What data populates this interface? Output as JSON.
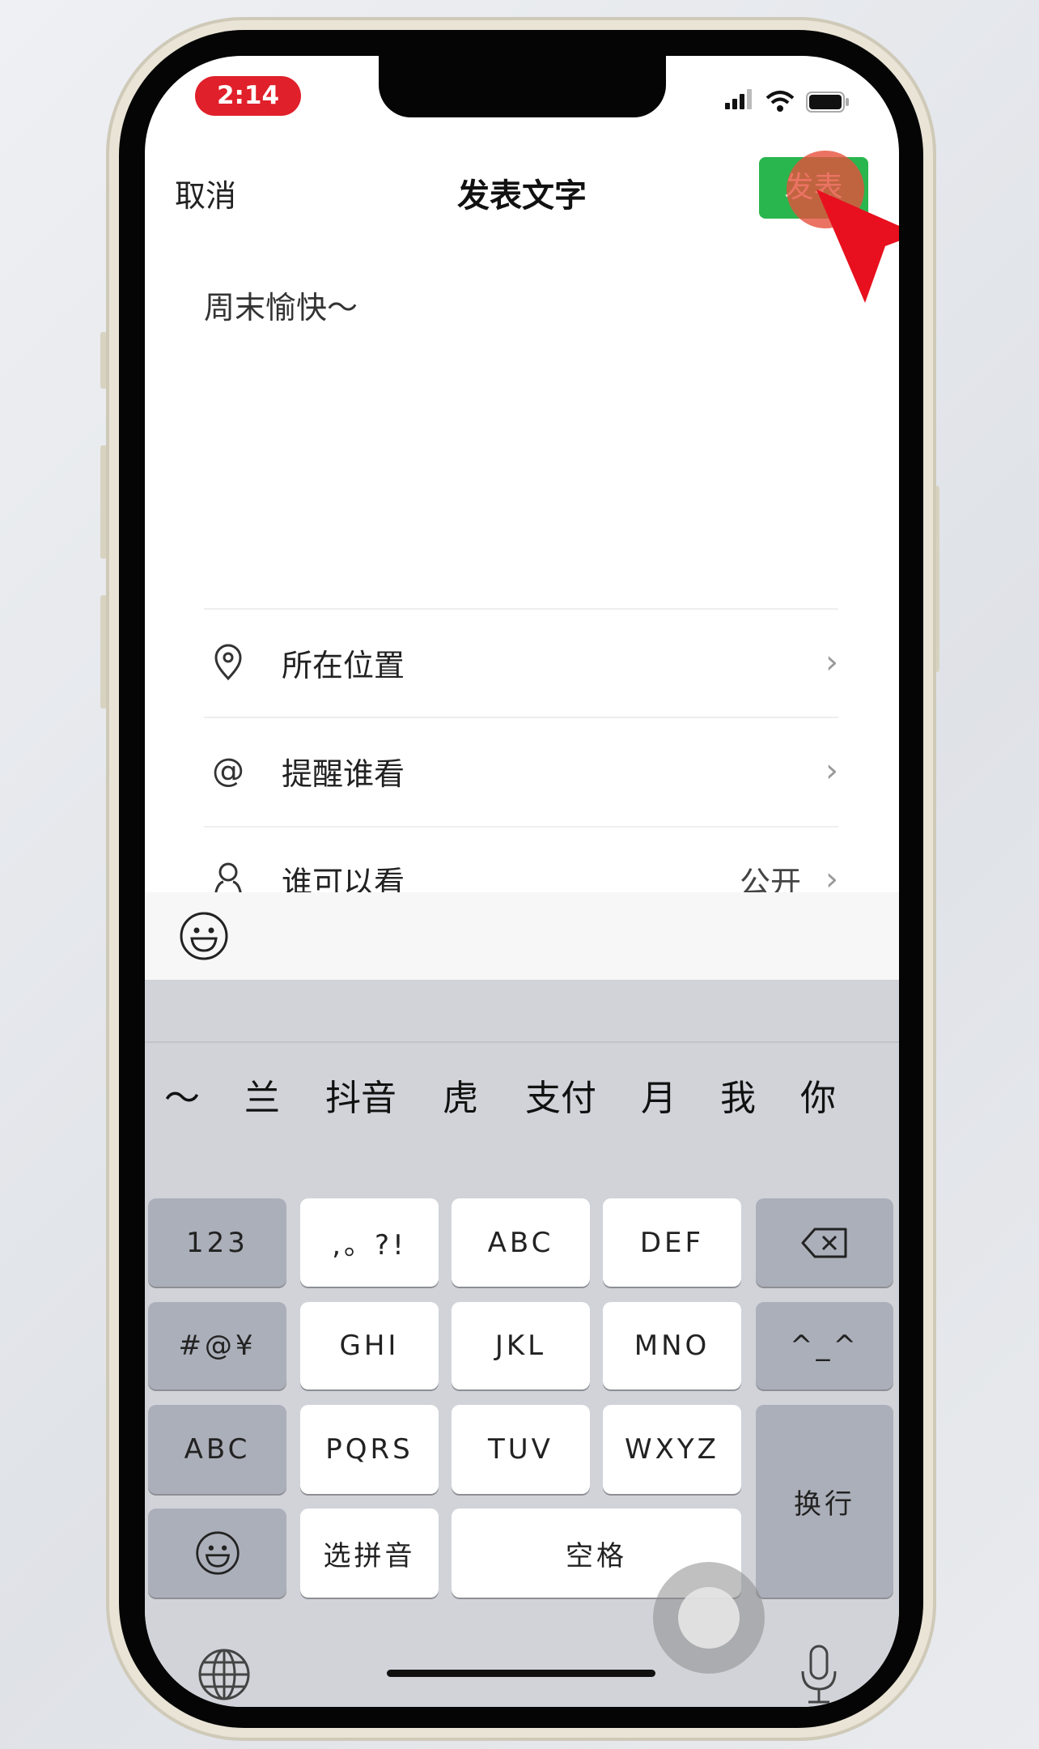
{
  "status_bar": {
    "time": "2:14",
    "signal_icon": "cellular-signal-icon",
    "wifi_icon": "wifi-icon",
    "battery_icon": "battery-icon"
  },
  "nav": {
    "cancel_label": "取消",
    "title": "发表文字",
    "send_label": "发表"
  },
  "compose": {
    "text": "周末愉快～"
  },
  "options": [
    {
      "icon": "location-pin-icon",
      "label": "所在位置",
      "value": ""
    },
    {
      "icon": "at-icon",
      "label": "提醒谁看",
      "value": ""
    },
    {
      "icon": "person-icon",
      "label": "谁可以看",
      "value": "公开"
    }
  ],
  "emoji_bar": {
    "icon": "emoji-icon"
  },
  "keyboard": {
    "candidates": [
      "～",
      "兰",
      "抖音",
      "虎",
      "支付",
      "月",
      "我",
      "你"
    ],
    "keys": {
      "num": "123",
      "punct": ",。?!",
      "abc2": "ABC",
      "def": "DEF",
      "delete_icon": "backspace-icon",
      "symbols": "#@¥",
      "ghi": "GHI",
      "jkl": "JKL",
      "mno": "MNO",
      "kaomoji": "^_^",
      "abc": "ABC",
      "pqrs": "PQRS",
      "tuv": "TUV",
      "wxyz": "WXYZ",
      "return": "换行",
      "emoji_icon": "emoji-icon",
      "pinyin": "选拼音",
      "space": "空格"
    },
    "globe_icon": "globe-icon",
    "mic_icon": "microphone-icon"
  },
  "annotation": {
    "color": "#e8101e",
    "shape": "red-arrow-pointer"
  },
  "colors": {
    "send_button": "#2ab64f",
    "time_pill": "#e0202a",
    "keyboard_bg": "#d1d3d9"
  }
}
